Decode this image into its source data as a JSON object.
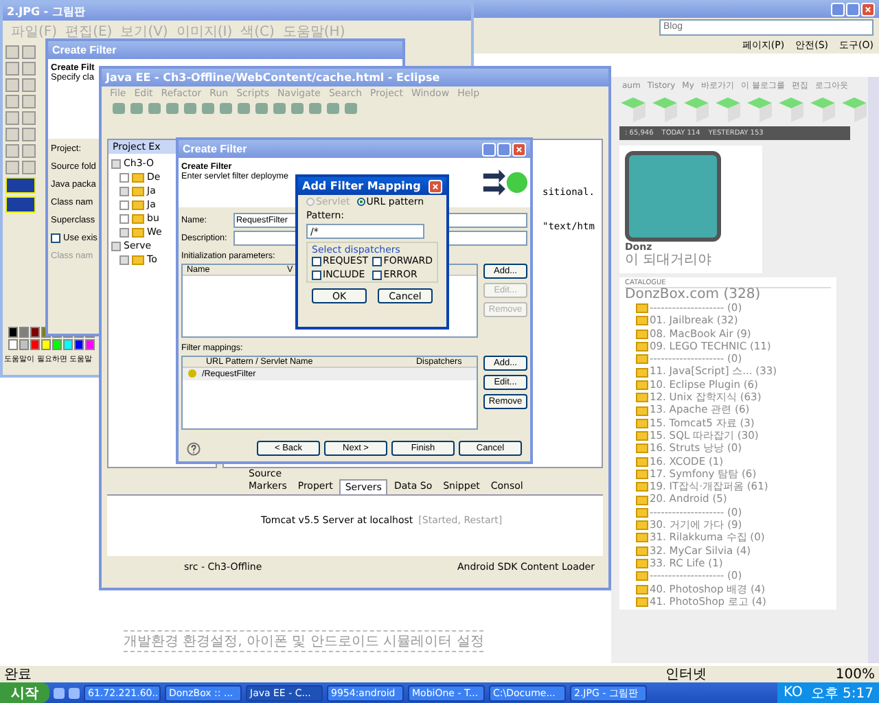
{
  "browser": {
    "search_placeholder": "Blog",
    "toolbar": [
      "페이지(P)",
      "안전(S)",
      "도구(O)"
    ],
    "nav": [
      "aum",
      "Tistory",
      "My",
      "바로가기",
      "이 블로그를",
      "편집",
      "로그아웃"
    ],
    "stats": [
      ": 65,946",
      "TODAY 114",
      "YESTERDAY 153"
    ],
    "profile": {
      "name": "Donz",
      "tagline": "이 되대거리야"
    },
    "catalogue": {
      "title": "CATALOGUE",
      "root": "DonzBox.com (328)",
      "items": [
        "-------------------- (0)",
        "01. Jailbreak (32)",
        "08. MacBook Air (9)",
        "09. LEGO TECHNIC (11)",
        "-------------------- (0)",
        "11. Java[Script] 스... (33)",
        "10. Eclipse Plugin (6)",
        "12. Unix 잡학지식 (63)",
        "13. Apache 관련 (6)",
        "15. Tomcat5 자료 (3)",
        "15. SQL 따라잡기 (30)",
        "16. Struts 낭낭 (0)",
        "16. XCODE (1)",
        "17. Symfony 탐탐 (6)",
        "19. IT잡식·개잡퍼옴 (61)",
        "20. Android (5)",
        "-------------------- (0)",
        "30. 거기에 가다 (9)",
        "31. Rilakkuma 수집 (0)",
        "32. MyCar Silvia (4)",
        "33. RC Life (1)",
        "-------------------- (0)",
        "40. Photoshop 배경 (4)",
        "41. PhotoShop 로고 (4)"
      ]
    },
    "article": "개발환경 환경설정, 아이폰 및 안드로이드 시뮬레이터 설정",
    "status": {
      "text": "완료",
      "zone": "인터넷",
      "zoom": "100%"
    }
  },
  "paint": {
    "title": "2.JPG - 그림판",
    "menu": [
      "파일(F)",
      "편집(E)",
      "보기(V)",
      "이미지(I)",
      "색(C)",
      "도움말(H)"
    ],
    "status": "도움말이 필요하면 도움말"
  },
  "back_dialog": {
    "title": "Create Filter",
    "heading": "Create Filt",
    "description": "Specify cla",
    "labels": [
      "Project:",
      "Source fold",
      "Java packa",
      "Class nam",
      "Superclass"
    ],
    "checkbox": {
      "label": "Use exis",
      "checked": false
    },
    "disabled_label": "Class nam"
  },
  "eclipse": {
    "title": "Java EE - Ch3-Offline/WebContent/cache.html - Eclipse",
    "menu": [
      "File",
      "Edit",
      "Refactor",
      "Run",
      "Scripts",
      "Navigate",
      "Search",
      "Project",
      "Window",
      "Help"
    ],
    "explorer_title": "Project Ex",
    "tree": [
      {
        "label": "Ch3-O",
        "expanded": true,
        "children": [
          {
            "label": "De",
            "expanded": false
          },
          {
            "label": "Ja",
            "expanded": true
          },
          {
            "label": "Ja",
            "expanded": false
          },
          {
            "label": "bu",
            "expanded": false
          },
          {
            "label": "We",
            "expanded": true
          }
        ]
      },
      {
        "label": "Serve",
        "expanded": true,
        "children": [
          {
            "label": "To",
            "expanded": true
          }
        ]
      }
    ],
    "editor_lines": [
      "sitional.",
      "\"text/htm"
    ],
    "source_tab": "Source",
    "views": [
      {
        "label": "Markers",
        "selected": false
      },
      {
        "label": "Propert",
        "selected": false
      },
      {
        "label": "Servers",
        "selected": true
      },
      {
        "label": "Data So",
        "selected": false
      },
      {
        "label": "Snippet",
        "selected": false
      },
      {
        "label": "Consol",
        "selected": false
      }
    ],
    "server": {
      "name": "Tomcat v5.5 Server at localhost",
      "state": "[Started, Restart]"
    },
    "status": [
      "src - Ch3-Offline",
      "Android SDK Content Loader"
    ]
  },
  "filter_dialog": {
    "title": "Create Filter",
    "heading": "Create Filter",
    "description": "Enter servlet filter deployme",
    "name_label": "Name:",
    "name_value": "RequestFilter",
    "description_label": "Description:",
    "init_label": "Initialization parameters:",
    "init_columns": [
      "Name",
      "V"
    ],
    "init_buttons": [
      {
        "label": "Add...",
        "disabled": false
      },
      {
        "label": "Edit...",
        "disabled": true
      },
      {
        "label": "Remove",
        "disabled": true
      }
    ],
    "mappings_label": "Filter mappings:",
    "mapping_columns": [
      "URL Pattern / Servlet Name",
      "Dispatchers"
    ],
    "mapping_rows": [
      "/RequestFilter"
    ],
    "mapping_buttons": [
      {
        "label": "Add...",
        "disabled": false
      },
      {
        "label": "Edit...",
        "disabled": false
      },
      {
        "label": "Remove",
        "disabled": false
      }
    ],
    "footer_buttons": [
      "< Back",
      "Next >",
      "Finish",
      "Cancel"
    ]
  },
  "mapping_dialog": {
    "title": "Add Filter Mapping",
    "radios": [
      {
        "label": "Servlet",
        "selected": false,
        "disabled": true
      },
      {
        "label": "URL pattern",
        "selected": true,
        "disabled": false
      }
    ],
    "pattern_label": "Pattern:",
    "pattern_value": "/*",
    "group_label": "Select dispatchers",
    "dispatchers": [
      {
        "label": "REQUEST",
        "checked": false
      },
      {
        "label": "FORWARD",
        "checked": false
      },
      {
        "label": "INCLUDE",
        "checked": false
      },
      {
        "label": "ERROR",
        "checked": false
      }
    ],
    "buttons": [
      "OK",
      "Cancel"
    ]
  },
  "taskbar": {
    "start": "시작",
    "tasks": [
      {
        "label": "61.72.221.60...",
        "selected": false
      },
      {
        "label": "DonzBox :: ...",
        "selected": false
      },
      {
        "label": "Java EE - C...",
        "selected": true
      },
      {
        "label": "9954:android",
        "selected": false
      },
      {
        "label": "MobiOne - T...",
        "selected": false
      },
      {
        "label": "C:\\Docume...",
        "selected": false
      },
      {
        "label": "2.JPG - 그림판",
        "selected": false
      }
    ],
    "lang": "KO",
    "clock": "오후 5:17"
  }
}
